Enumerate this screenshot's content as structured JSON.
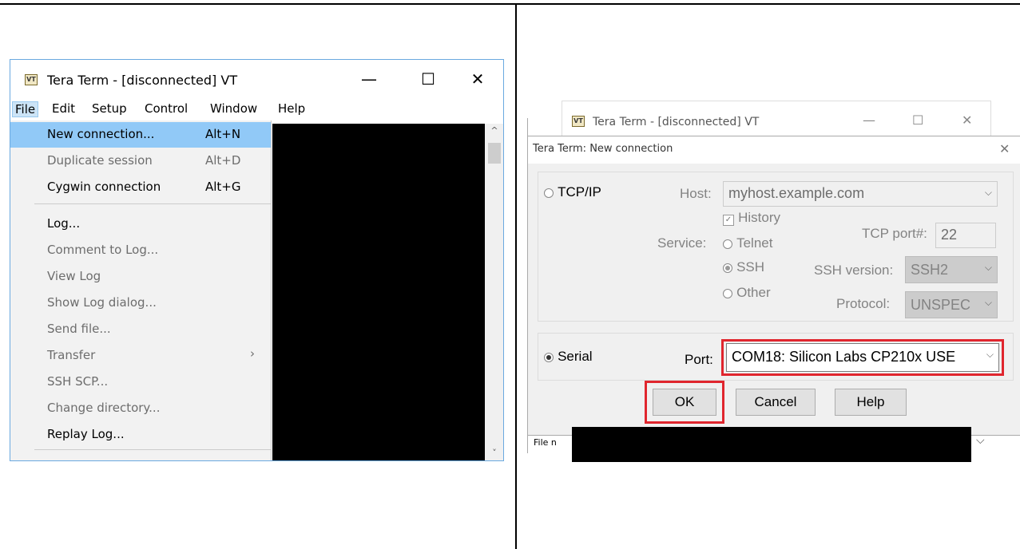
{
  "left_window": {
    "title": "Tera Term - [disconnected] VT",
    "icon": "VT",
    "controls": {
      "minimize": "—",
      "maximize": "☐",
      "close": "✕"
    },
    "menubar": [
      "File",
      "Edit",
      "Setup",
      "Control",
      "Window",
      "Help"
    ],
    "file_menu": [
      {
        "label": "New connection...",
        "shortcut": "Alt+N",
        "state": "highlighted"
      },
      {
        "label": "Duplicate session",
        "shortcut": "Alt+D",
        "state": "disabled"
      },
      {
        "label": "Cygwin connection",
        "shortcut": "Alt+G",
        "state": "enabled"
      },
      {
        "label": "Log...",
        "shortcut": "",
        "state": "enabled"
      },
      {
        "label": "Comment to Log...",
        "shortcut": "",
        "state": "disabled"
      },
      {
        "label": "View Log",
        "shortcut": "",
        "state": "disabled"
      },
      {
        "label": "Show Log dialog...",
        "shortcut": "",
        "state": "disabled"
      },
      {
        "label": "Send file...",
        "shortcut": "",
        "state": "disabled"
      },
      {
        "label": "Transfer",
        "shortcut": "",
        "state": "disabled",
        "submenu": true
      },
      {
        "label": "SSH SCP...",
        "shortcut": "",
        "state": "disabled"
      },
      {
        "label": "Change directory...",
        "shortcut": "",
        "state": "disabled"
      },
      {
        "label": "Replay Log...",
        "shortcut": "",
        "state": "enabled"
      }
    ],
    "submenu_glyph": "›",
    "scroll_up": "^",
    "scroll_down": "˅"
  },
  "right_window": {
    "title": "Tera Term - [disconnected] VT",
    "icon": "VT",
    "controls": {
      "minimize": "—",
      "maximize": "☐",
      "close": "✕"
    },
    "file_label": "File n"
  },
  "dialog": {
    "title": "Tera Term: New connection",
    "close": "✕",
    "tcpip": {
      "label": "TCP/IP",
      "host_label": "Host:",
      "host_value": "myhost.example.com",
      "history_label": "History",
      "service_label": "Service:",
      "services": [
        "Telnet",
        "SSH",
        "Other"
      ],
      "tcp_port_label": "TCP port#:",
      "tcp_port_value": "22",
      "ssh_version_label": "SSH version:",
      "ssh_version_value": "SSH2",
      "protocol_label": "Protocol:",
      "protocol_value": "UNSPEC"
    },
    "serial": {
      "label": "Serial",
      "port_label": "Port:",
      "port_value": "COM18: Silicon Labs CP210x USE"
    },
    "buttons": {
      "ok": "OK",
      "cancel": "Cancel",
      "help": "Help"
    },
    "chevron": "⌵",
    "highlight_color": "#e0262e"
  }
}
